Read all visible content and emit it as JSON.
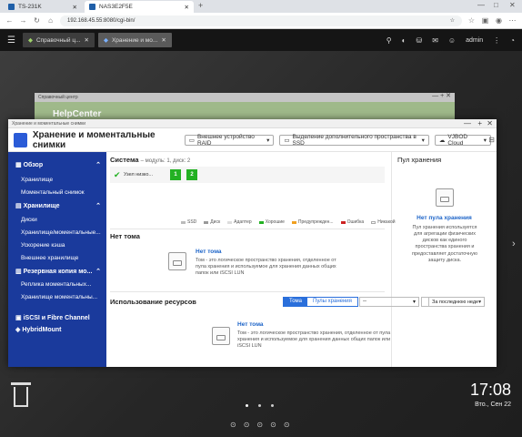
{
  "browser": {
    "tabs": [
      {
        "label": "TS-231K"
      },
      {
        "label": "NAS3E2F5E"
      }
    ],
    "url": "192.168.45.55:8080/cgi-bin/"
  },
  "qts": {
    "apps": [
      {
        "label": "Справочный ц..."
      },
      {
        "label": "Хранение и мо..."
      }
    ],
    "user": "admin"
  },
  "help": {
    "window_title": "Справочный центр",
    "title": "HelpCenter"
  },
  "storage": {
    "window_title": "Хранение и моментальные снимки",
    "app_title": "Хранение и моментальные снимки",
    "header_buttons": [
      {
        "label": "Внешнее устройство RAID"
      },
      {
        "label": "Выделение дополнительного пространства в SSD"
      },
      {
        "label": "VJBOD Cloud"
      }
    ],
    "sidebar": {
      "overview": "Обзор",
      "storage": "Хранилище",
      "snapshots": "Моментальный снимок",
      "storage_h": "Хранилище",
      "disks": "Диски",
      "storage_snap": "Хранилище/моментальные...",
      "cache": "Ускорение кэша",
      "external": "Внешнее хранилище",
      "backup_h": "Резервная копия мо...",
      "snap_rep": "Реплика моментальных...",
      "snap_store": "Хранилище моментальны...",
      "iscsi": "iSCSI и Fibre Channel",
      "hybrid": "HybridMount"
    },
    "system": {
      "label": "Система",
      "sub": "– модуль: 1, диск: 2",
      "node": "Узел низко...",
      "slots": [
        "1",
        "2"
      ]
    },
    "legend": [
      {
        "label": "SSD",
        "color": "#bbbbbb"
      },
      {
        "label": "Диск",
        "color": "#999999"
      },
      {
        "label": "Адаптер",
        "color": "#dddddd"
      },
      {
        "label": "Хорошие",
        "color": "#23b123"
      },
      {
        "label": "Предупрежден...",
        "color": "#f0a020"
      },
      {
        "label": "Ошибка",
        "color": "#cc2222"
      },
      {
        "label": "Никакой",
        "color": "#ffffff"
      }
    ],
    "no_volume": {
      "heading": "Нет тома",
      "title": "Нет тома",
      "desc": "Том - это логическое пространство хранения, отделенное от пула хранения и используемое для хранения данных общих папок или iSCSI LUN"
    },
    "pool": {
      "heading": "Пул хранения",
      "title": "Нет пула хранения",
      "desc": "Пул хранения используется для агрегации физических дисков как единого пространства хранения и предоставляет достаточную защиту диска."
    },
    "usage": {
      "heading": "Использование ресурсов",
      "tab_volume": "Тома",
      "tab_pool": "Пулы хранения",
      "select": "--",
      "period": "За последнюю неде",
      "title": "Нет тома",
      "desc": "Том - это логическое пространство хранения, отделенное от пула хранения и используемое для хранения данных общих папок или iSCSI LUN"
    }
  },
  "desktop": {
    "time": "17:08",
    "date": "Вто., Сен 22"
  }
}
